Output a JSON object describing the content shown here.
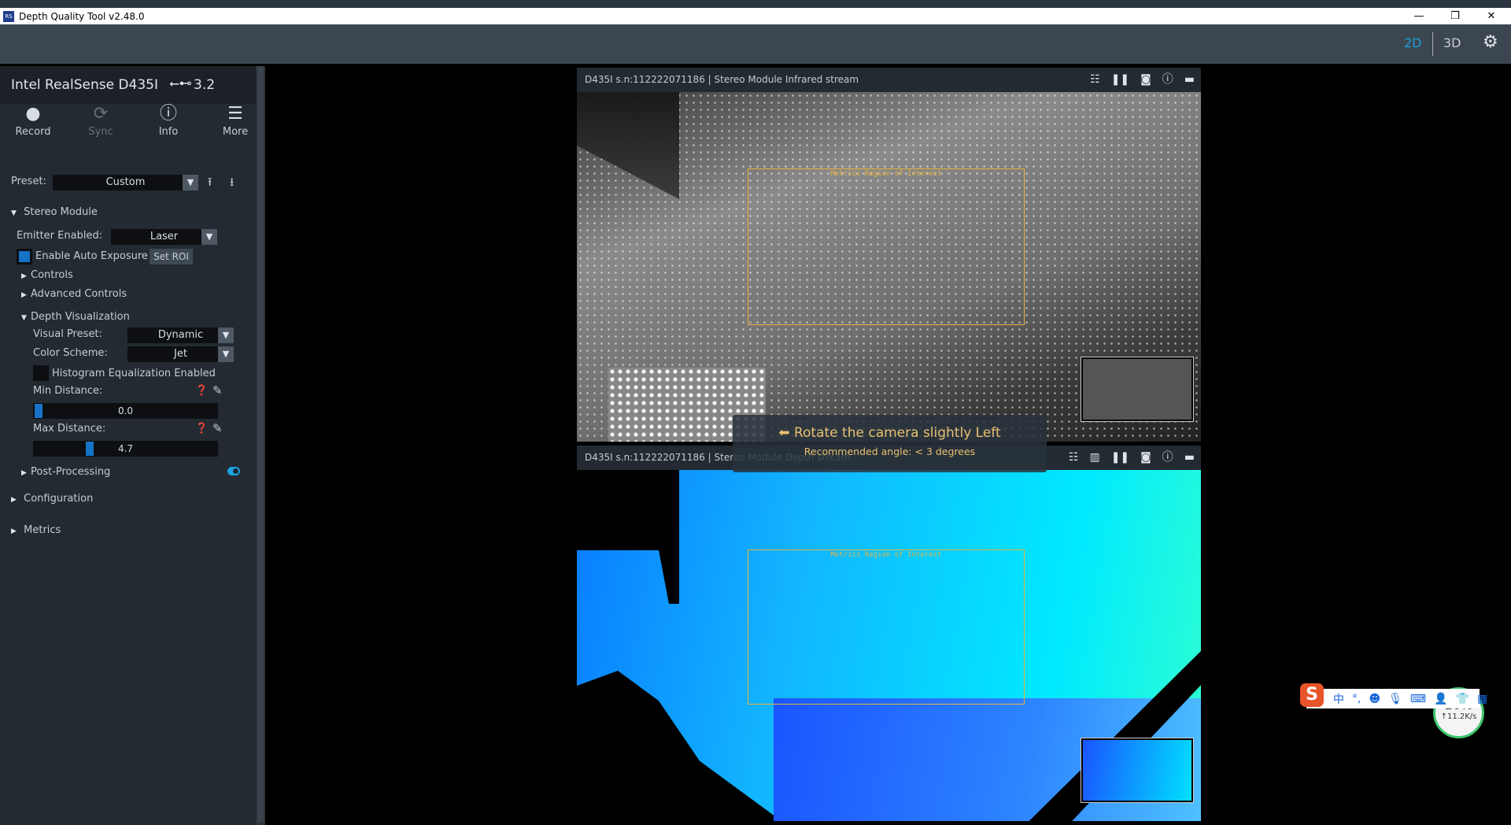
{
  "window": {
    "title": "Depth Quality Tool v2.48.0",
    "minimize": "—",
    "restore": "❐",
    "close": "✕"
  },
  "toolbar": {
    "mode_2d": "2D",
    "mode_3d": "3D",
    "accent": "#1a9fd8"
  },
  "device": {
    "name": "Intel RealSense D435I",
    "usb_icon": "usb-icon",
    "usb": "3.2",
    "buttons": [
      {
        "label": "Record",
        "icon": "●"
      },
      {
        "label": "Sync",
        "icon": "⟳"
      },
      {
        "label": "Info",
        "icon": "ⓘ"
      },
      {
        "label": "More",
        "icon": "☰"
      }
    ]
  },
  "preset": {
    "label": "Preset:",
    "value": "Custom"
  },
  "stereo": {
    "title": "Stereo Module",
    "emitter_label": "Emitter Enabled:",
    "emitter_value": "Laser",
    "auto_exposure": "Enable Auto Exposure",
    "auto_exposure_checked": true,
    "set_roi": "Set ROI",
    "controls": "Controls",
    "advanced": "Advanced Controls",
    "depth_vis": {
      "title": "Depth Visualization",
      "visual_preset_label": "Visual Preset:",
      "visual_preset": "Dynamic",
      "color_scheme_label": "Color Scheme:",
      "color_scheme": "Jet",
      "histogram": "Histogram Equalization Enabled",
      "histogram_checked": false,
      "min_label": "Min Distance:",
      "min_value": "0.0",
      "max_label": "Max Distance:",
      "max_value": "4.7"
    },
    "post_processing": "Post-Processing",
    "post_processing_on": true
  },
  "sections": {
    "configuration": "Configuration",
    "metrics": "Metrics"
  },
  "streams": {
    "infrared": {
      "title": "D435I s.n:112222071186 | Stereo Module Infrared stream",
      "roi": "Metrics Region of Interest"
    },
    "depth": {
      "title": "D435I s.n:112222071186 | Stereo Module Depth stream",
      "roi": "Metrics Region of Interest"
    }
  },
  "notification": {
    "message": "Rotate the camera slightly Left",
    "detail": "Recommended angle: < 3 degrees"
  },
  "ime": {
    "lang": "中",
    "punct": "°,",
    "speed": "↑11.2K/s",
    "percent": "26%"
  }
}
